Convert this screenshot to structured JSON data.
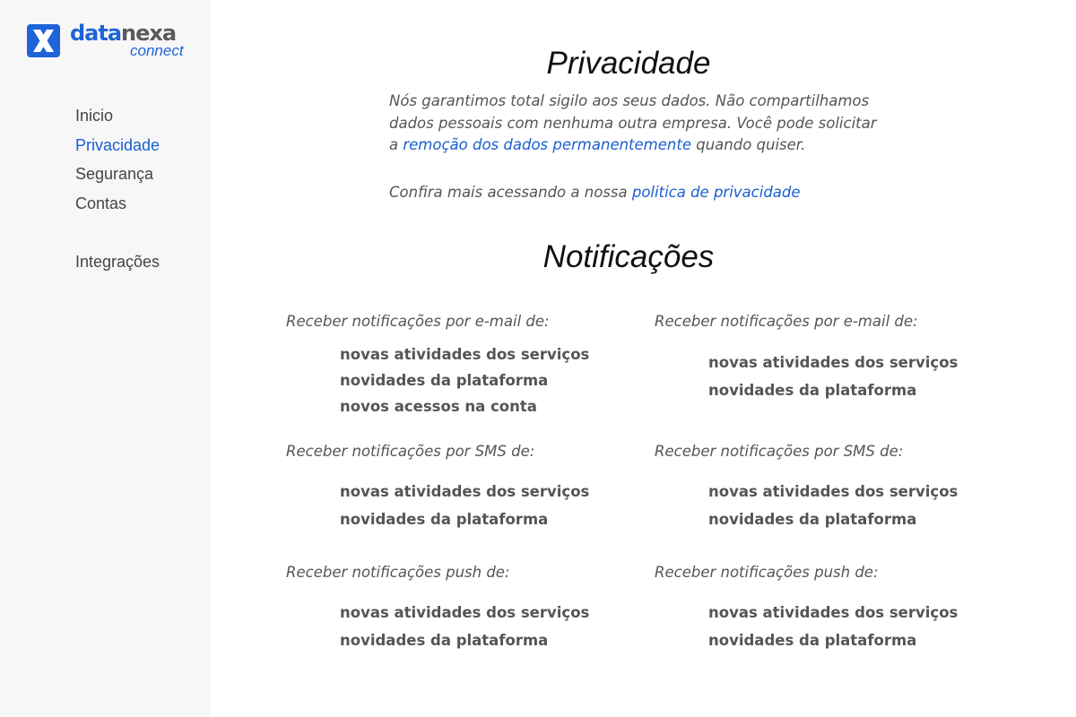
{
  "brand": {
    "word_part1": "data",
    "word_part2": "nexa",
    "subtitle": "connect",
    "icon": "x-logo-icon",
    "colors": {
      "primary": "#1f63d8",
      "secondary": "#5a5a5a"
    }
  },
  "nav": {
    "items": [
      {
        "label": "Inicio"
      },
      {
        "label": "Privacidade",
        "active": true
      },
      {
        "label": "Segurança"
      },
      {
        "label": "Contas"
      },
      {
        "label": "Integrações"
      }
    ]
  },
  "privacy": {
    "title": "Privacidade",
    "text_line1": "Nós garantimos total sigilo aos seus dados. Não compartilhamos",
    "text_line2": "dados pessoais com nenhuma outra empresa. Você pode solicitar",
    "text_line3_prefix": "a ",
    "removal_link": "remoção dos dados permanentemente",
    "text_line3_suffix": " quando quiser.",
    "more_prefix": "Confira mais acessando a nossa ",
    "policy_link": "politica de privacidade"
  },
  "notifications": {
    "title": "Notificações",
    "columns": [
      {
        "email_label": "Receber notificações por e-mail de:",
        "email_options": [
          "novas atividades dos serviços",
          "novidades da plataforma",
          "novos acessos na conta"
        ],
        "sms_label": "Receber notificações por SMS de:",
        "sms_options": [
          "novas atividades dos serviços",
          "novidades da plataforma"
        ],
        "push_label": "Receber notificações push de:",
        "push_options": [
          "novas atividades dos serviços",
          "novidades da plataforma"
        ]
      },
      {
        "email_label": "Receber notificações por e-mail de:",
        "email_options": [
          "novas atividades dos serviços",
          "novidades da plataforma"
        ],
        "sms_label": "Receber notificações por SMS de:",
        "sms_options": [
          "novas atividades dos serviços",
          "novidades da plataforma"
        ],
        "push_label": "Receber notificações push de:",
        "push_options": [
          "novas atividades dos serviços",
          "novidades da plataforma"
        ]
      }
    ]
  },
  "colors": {
    "link": "#1a5fd0",
    "sidebar_bg": "#f7f7f7",
    "text": "#555555"
  }
}
